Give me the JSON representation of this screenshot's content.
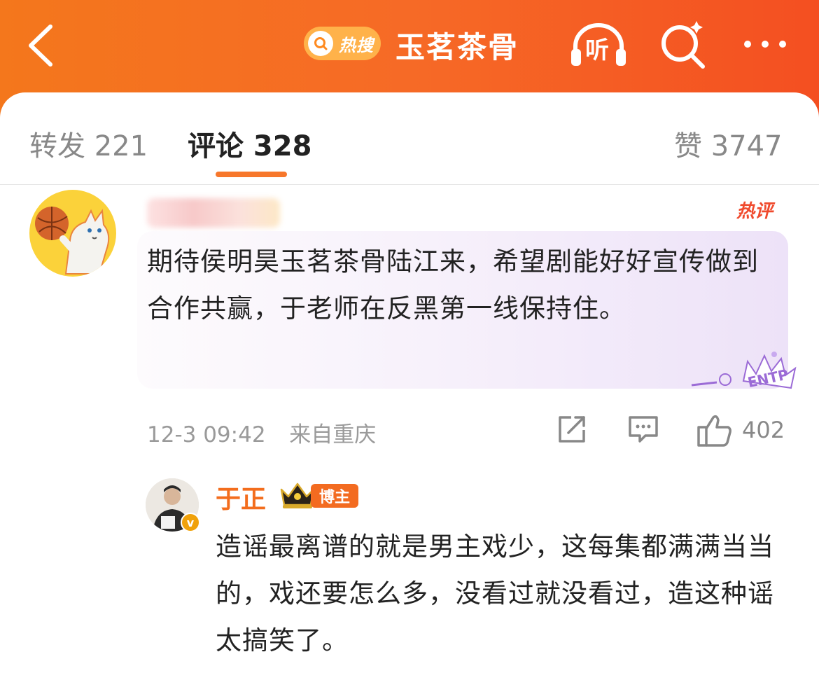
{
  "header": {
    "hot_search_badge": "热搜",
    "topic_title": "玉茗茶骨",
    "listen_label": "听",
    "brand_color": "#f66a26"
  },
  "tabs": [
    {
      "label": "转发 221",
      "active": false
    },
    {
      "label": "评论 328",
      "active": true
    },
    {
      "label": "赞 3747",
      "active": false
    }
  ],
  "comment": {
    "hot_tag": "热评",
    "text": "期待侯明昊玉茗茶骨陆江来，希望剧能好好宣传做到合作共赢，于老师在反黑第一线保持住。",
    "time": "12-3 09:42",
    "location": "来自重庆",
    "likes": "402",
    "icons": [
      "share-icon",
      "comment-icon",
      "thumbs-up-icon"
    ]
  },
  "reply": {
    "author": "于正",
    "role_badge": "博主",
    "verified_icon": "v",
    "text": "造谣最离谱的就是男主戏少，这每集都满满当当的，戏还要怎么多，没看过就没看过，造这种谣太搞笑了。"
  }
}
